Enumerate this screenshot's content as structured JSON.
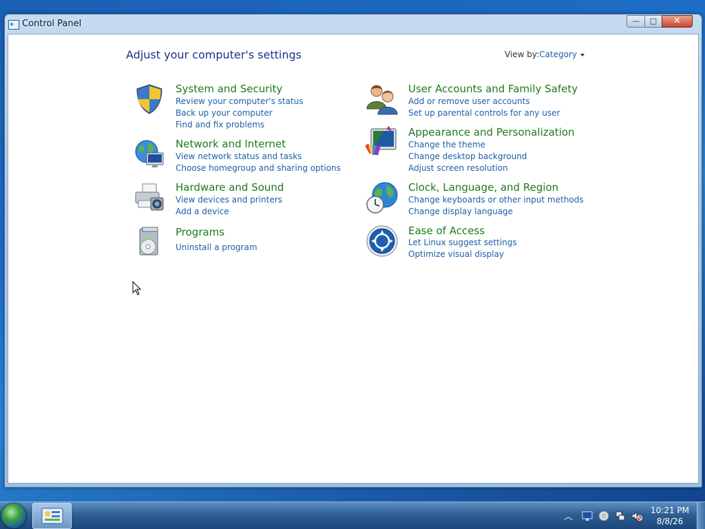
{
  "window": {
    "title": "Control Panel",
    "buttons": {
      "minimize": "—",
      "maximize": "□",
      "close": "✕"
    }
  },
  "header": {
    "title": "Adjust your computer's settings",
    "view_by_label": "View by:",
    "view_by_value": "Category"
  },
  "categories": [
    {
      "title": "System and Security",
      "icon": "shield-icon",
      "links": [
        "Review your computer's status",
        "Back up your computer",
        "Find and fix problems"
      ]
    },
    {
      "title": "Network and Internet",
      "icon": "network-globe-icon",
      "links": [
        "View network status and tasks",
        "Choose homegroup and sharing options"
      ]
    },
    {
      "title": "Hardware and Sound",
      "icon": "printer-camera-icon",
      "links": [
        "View devices and printers",
        "Add a device"
      ]
    },
    {
      "title": "Programs",
      "icon": "programs-disc-icon",
      "links": [
        "Uninstall a program"
      ]
    },
    {
      "title": "User Accounts and Family Safety",
      "icon": "users-icon",
      "links": [
        "Add or remove user accounts",
        "Set up parental controls for any user"
      ]
    },
    {
      "title": "Appearance and Personalization",
      "icon": "monitor-palette-icon",
      "links": [
        "Change the theme",
        "Change desktop background",
        "Adjust screen resolution"
      ]
    },
    {
      "title": "Clock, Language, and Region",
      "icon": "clock-globe-icon",
      "links": [
        "Change keyboards or other input methods",
        "Change display language"
      ]
    },
    {
      "title": "Ease of Access",
      "icon": "ease-of-access-icon",
      "links": [
        "Let Linux suggest settings",
        "Optimize visual display"
      ]
    }
  ],
  "taskbar": {
    "clock_time": "10:21 PM",
    "clock_date": "8/8/26",
    "tray_icons": [
      "show-hidden-icons-chevron",
      "action-center-icon",
      "disc-icon",
      "network-icon",
      "volume-muted-icon"
    ]
  }
}
